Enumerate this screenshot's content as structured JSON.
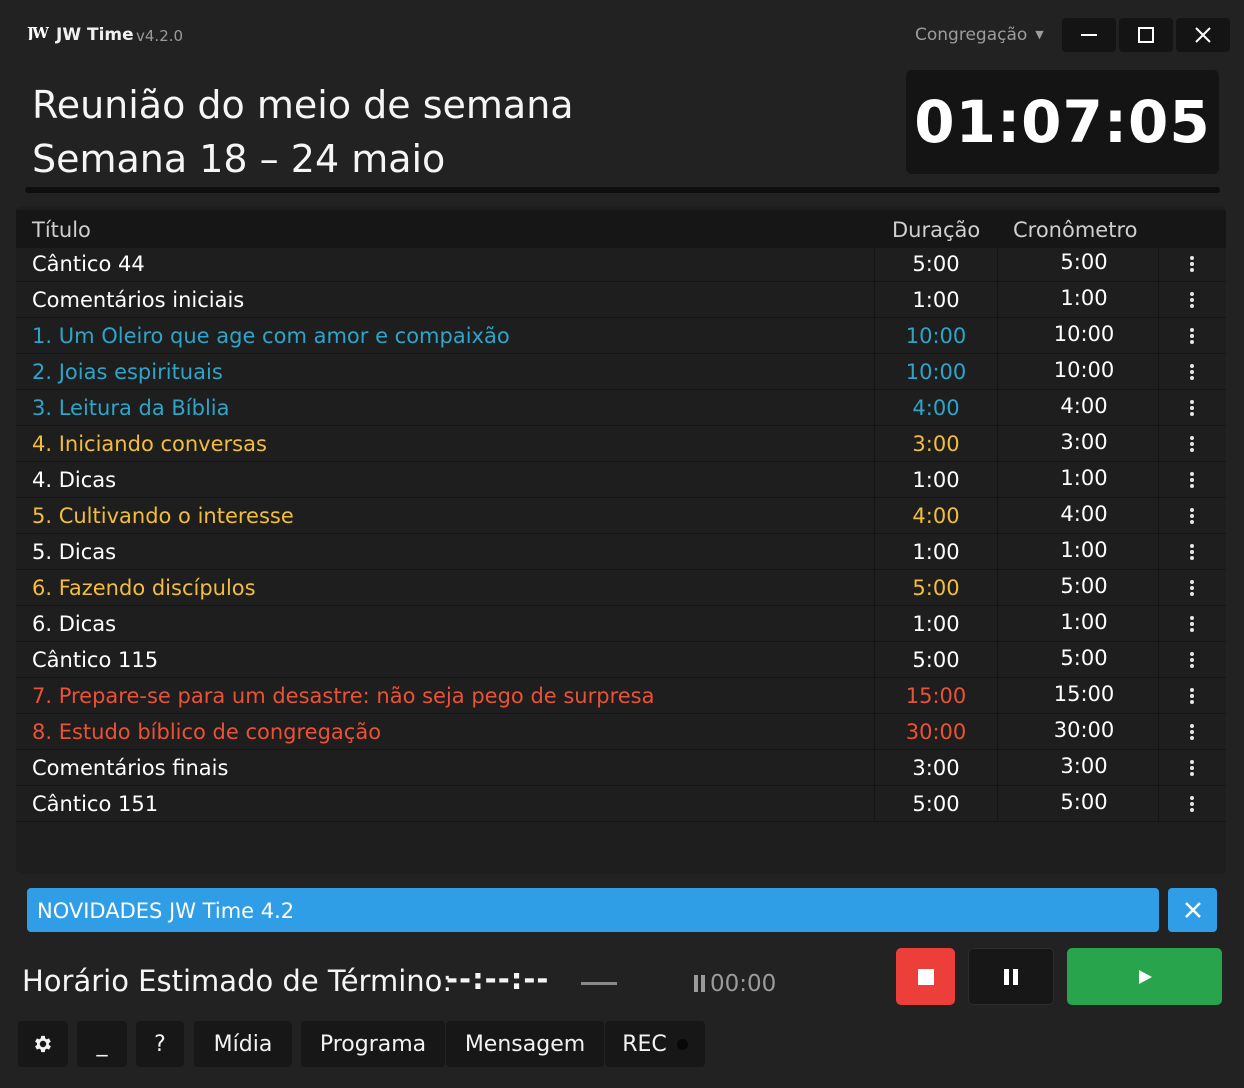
{
  "titlebar": {
    "logo": "JW",
    "app_name": "JW Time",
    "version": "v4.2.0",
    "congregation_select": "Congregação"
  },
  "header": {
    "title_line1": "Reunião do meio de semana",
    "title_line2": "Semana 18 – 24 maio",
    "clock": "01:07:05"
  },
  "table": {
    "headers": {
      "title": "Título",
      "duration": "Duração",
      "timer": "Cronômetro"
    },
    "rows": [
      {
        "title": "Cântico 44",
        "duration": "5:00",
        "timer": "5:00",
        "color": "#ffffff"
      },
      {
        "title": "Comentários iniciais",
        "duration": "1:00",
        "timer": "1:00",
        "color": "#ffffff"
      },
      {
        "title": "1. Um Oleiro que age com amor e compaixão",
        "duration": "10:00",
        "timer": "10:00",
        "color": "#2ca5c9"
      },
      {
        "title": "2. Joias espirituais",
        "duration": "10:00",
        "timer": "10:00",
        "color": "#2ca5c9"
      },
      {
        "title": "3. Leitura da Bíblia",
        "duration": "4:00",
        "timer": "4:00",
        "color": "#2ca5c9"
      },
      {
        "title": "4. Iniciando conversas",
        "duration": "3:00",
        "timer": "3:00",
        "color": "#f2be3a"
      },
      {
        "title": "4. Dicas",
        "duration": "1:00",
        "timer": "1:00",
        "color": "#ffffff"
      },
      {
        "title": "5. Cultivando o interesse",
        "duration": "4:00",
        "timer": "4:00",
        "color": "#f2be3a"
      },
      {
        "title": "5. Dicas",
        "duration": "1:00",
        "timer": "1:00",
        "color": "#ffffff"
      },
      {
        "title": "6. Fazendo discípulos",
        "duration": "5:00",
        "timer": "5:00",
        "color": "#f2be3a"
      },
      {
        "title": "6. Dicas",
        "duration": "1:00",
        "timer": "1:00",
        "color": "#ffffff"
      },
      {
        "title": "Cântico 115",
        "duration": "5:00",
        "timer": "5:00",
        "color": "#ffffff"
      },
      {
        "title": "7. Prepare-se para um desastre: não seja pego de surpresa",
        "duration": "15:00",
        "timer": "15:00",
        "color": "#ea5236"
      },
      {
        "title": "8. Estudo bíblico de congregação",
        "duration": "30:00",
        "timer": "30:00",
        "color": "#ea5236"
      },
      {
        "title": "Comentários finais",
        "duration": "3:00",
        "timer": "3:00",
        "color": "#ffffff"
      },
      {
        "title": "Cântico 151",
        "duration": "5:00",
        "timer": "5:00",
        "color": "#ffffff"
      }
    ]
  },
  "news": {
    "text": "NOVIDADES JW Time 4.2"
  },
  "status": {
    "eta_label": "Horário Estimado de Término:",
    "eta_value": "--:--:--",
    "pause_time": "00:00"
  },
  "toolbar": {
    "minimize_label": "_",
    "help_label": "?",
    "media_label": "Mídia",
    "program_label": "Programa",
    "message_label": "Mensagem",
    "rec_label": "REC"
  },
  "colors": {
    "background": "#222223",
    "accent_blue": "#2f9ee6",
    "stop_red": "#ec3f3a",
    "play_green": "#27a44c"
  },
  "icons": [
    "app-logo",
    "caret-down",
    "minimize",
    "maximize",
    "close",
    "more-vertical",
    "stop",
    "pause",
    "play",
    "gear"
  ]
}
